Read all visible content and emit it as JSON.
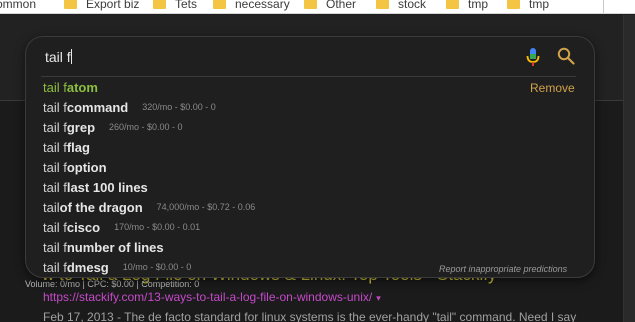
{
  "bookmarks": [
    {
      "label": "ommon",
      "folder": false
    },
    {
      "label": "Export biz",
      "folder": true
    },
    {
      "label": "Tets",
      "folder": true
    },
    {
      "label": "necessary",
      "folder": true
    },
    {
      "label": "Other",
      "folder": true
    },
    {
      "label": "stock",
      "folder": true
    },
    {
      "label": "tmp",
      "folder": true
    },
    {
      "label": "tmp",
      "folder": true
    }
  ],
  "search": {
    "query": "tail f",
    "remove_label": "Remove",
    "report_label": "Report inappropriate predictions"
  },
  "suggestions": [
    {
      "base": "tail f ",
      "completion": "atom",
      "stats": ""
    },
    {
      "base": "tail f ",
      "completion": "command",
      "stats": "320/mo - $0.00 - 0"
    },
    {
      "base": "tail f ",
      "completion": "grep",
      "stats": "260/mo - $0.00 - 0"
    },
    {
      "base": "tail f ",
      "completion": "flag",
      "stats": ""
    },
    {
      "base": "tail f ",
      "completion": "option",
      "stats": ""
    },
    {
      "base": "tail f ",
      "completion": "last 100 lines",
      "stats": ""
    },
    {
      "base": "tail ",
      "completion": "of the dragon",
      "stats": "74,000/mo - $0.72 - 0.06"
    },
    {
      "base": "tail f ",
      "completion": "cisco",
      "stats": "170/mo - $0.00 - 0.01"
    },
    {
      "base": "tail f ",
      "completion": "number of lines",
      "stats": ""
    },
    {
      "base": "tail f ",
      "completion": "dmesg",
      "stats": "10/mo - $0.00 - 0"
    }
  ],
  "result": {
    "title": "w to Tail a Log File on Windows & Linux: Top Tools - Stackify",
    "meta": "Volume: 0/mo | CPC: $0.00 | Competition: 0",
    "url": "https://stackify.com/13-ways-to-tail-a-log-file-on-windows-unix/",
    "url_caret": "▾",
    "snippet": "Feb 17, 2013 - The de facto standard for linux systems is the ever-handy \"tail\" command. Need I say"
  },
  "colors": {
    "accent_remove": "#d0a24a",
    "first_suggestion": "#8dbf3f",
    "result_title": "#d4cb3a",
    "result_url": "#c54ac8"
  },
  "icons": {
    "mic": "microphone-icon",
    "search": "search-icon",
    "folder": "folder-icon"
  }
}
